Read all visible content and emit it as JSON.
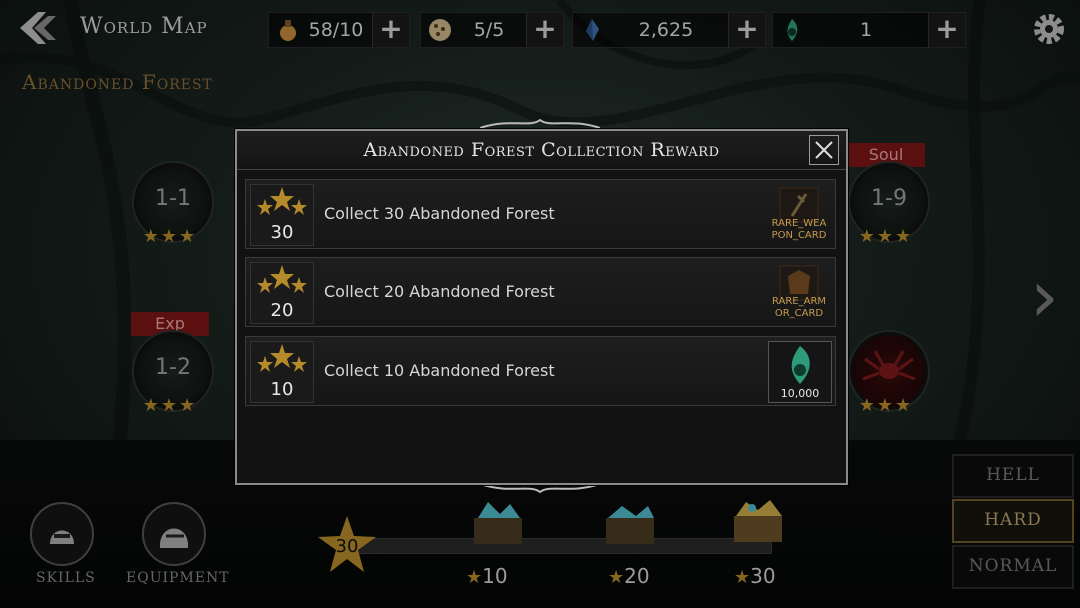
{
  "header": {
    "title": "World Map",
    "area": "Abandoned Forest"
  },
  "resources": [
    {
      "icon": "potion-icon",
      "value": "58/10"
    },
    {
      "icon": "cookie-icon",
      "value": "5/5"
    },
    {
      "icon": "blue-crystal-icon",
      "value": "2,625"
    },
    {
      "icon": "green-soul-icon",
      "value": "1"
    }
  ],
  "stages": {
    "s11": "1-1",
    "s12": "1-2",
    "s19": "1-9",
    "tag_exp": "Exp",
    "tag_soul": "Soul",
    "stars": "★★★"
  },
  "modal": {
    "title": "Abandoned Forest Collection Reward",
    "rows": [
      {
        "stars": "30",
        "text": "Collect 30 Abandoned Forest",
        "reward_label": "RARE_WEAPON_CARD",
        "reward_line1": "RARE_WEA",
        "reward_line2": "PON_CARD"
      },
      {
        "stars": "20",
        "text": "Collect 20 Abandoned Forest",
        "reward_label": "RARE_ARMOR_CARD",
        "reward_line1": "RARE_ARM",
        "reward_line2": "OR_CARD"
      },
      {
        "stars": "10",
        "text": "Collect 10 Abandoned Forest",
        "reward_label": "10,000",
        "reward_line1": "10,000",
        "reward_line2": ""
      }
    ]
  },
  "difficulty": {
    "hell": "HELL",
    "hard": "HARD",
    "normal": "NORMAL",
    "active": "HARD"
  },
  "bottom": {
    "skills": "SKILLS",
    "equipment": "EQUIPMENT",
    "progress_stars": "30",
    "milestones": [
      "10",
      "20",
      "30"
    ]
  },
  "colors": {
    "gold": "#b48a2a",
    "hard_border": "#6f5a28",
    "soul_tag": "#7a1414"
  }
}
